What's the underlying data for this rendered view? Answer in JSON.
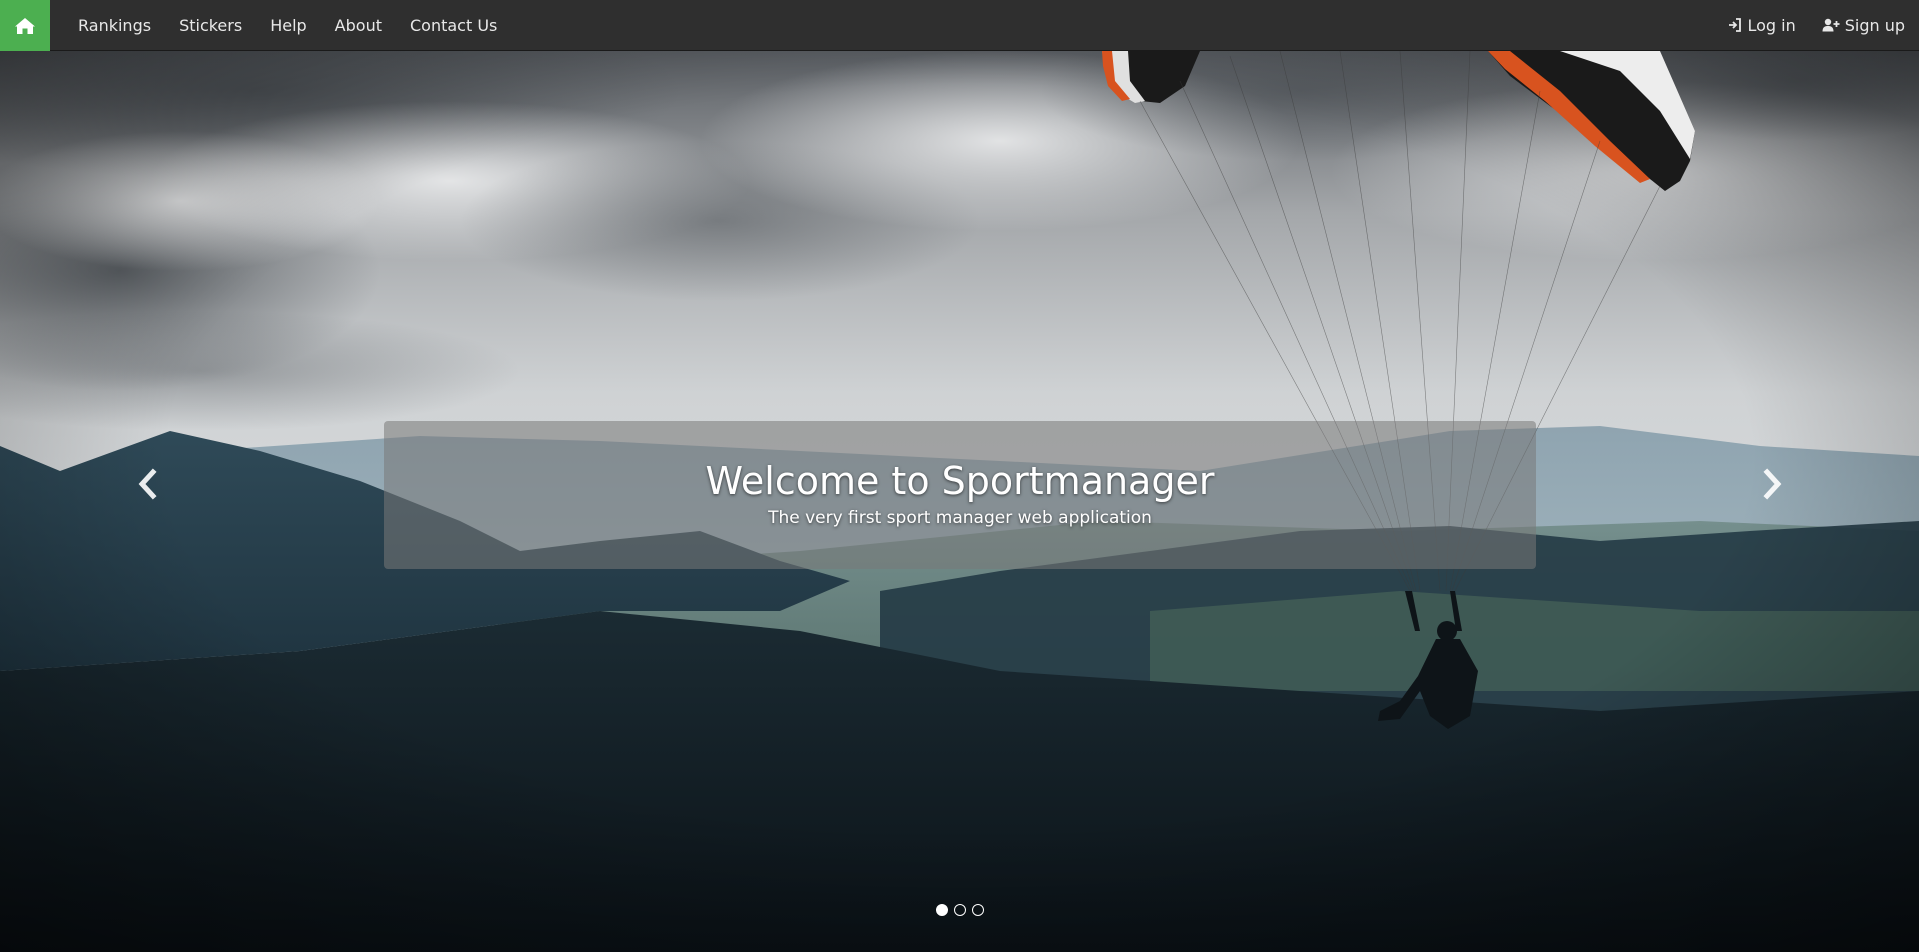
{
  "navbar": {
    "brand_icon": "home-icon",
    "brand_color": "#4caf50",
    "links": [
      {
        "label": "Rankings"
      },
      {
        "label": "Stickers"
      },
      {
        "label": "Help"
      },
      {
        "label": "About"
      },
      {
        "label": "Contact Us"
      }
    ],
    "login": {
      "label": "Log in",
      "icon": "sign-in-icon"
    },
    "signup": {
      "label": "Sign up",
      "icon": "user-plus-icon"
    }
  },
  "carousel": {
    "title": "Welcome to Sportmanager",
    "subtitle": "The very first sport manager web application",
    "prev_icon": "chevron-left-icon",
    "next_icon": "chevron-right-icon",
    "slide_count": 3,
    "active_slide": 1,
    "image": "paraglider-over-mountains"
  }
}
